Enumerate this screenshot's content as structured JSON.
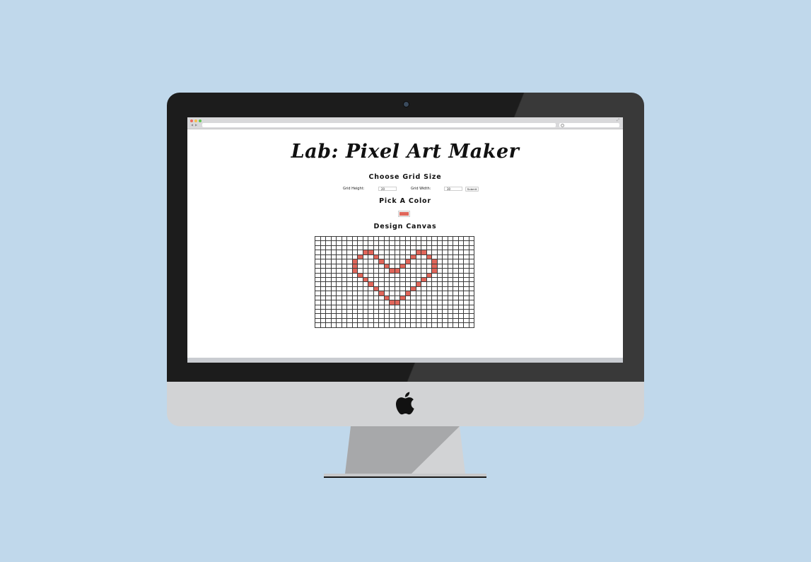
{
  "page": {
    "title": "Lab: Pixel Art Maker"
  },
  "grid_form": {
    "heading": "Choose Grid Size",
    "height_label": "Grid Height:",
    "height_value": "20",
    "width_label": "Grid Width:",
    "width_value": "30",
    "submit_label": "Submit"
  },
  "color_section": {
    "heading": "Pick A Color",
    "selected_color": "#e0665a"
  },
  "canvas_section": {
    "heading": "Design Canvas",
    "rows": 20,
    "cols": 30,
    "filled_color": "#e0665a",
    "filled_cells": [
      [
        3,
        9
      ],
      [
        3,
        10
      ],
      [
        3,
        19
      ],
      [
        3,
        20
      ],
      [
        4,
        8
      ],
      [
        4,
        11
      ],
      [
        4,
        18
      ],
      [
        4,
        21
      ],
      [
        5,
        7
      ],
      [
        5,
        12
      ],
      [
        5,
        17
      ],
      [
        5,
        22
      ],
      [
        6,
        7
      ],
      [
        6,
        13
      ],
      [
        6,
        16
      ],
      [
        6,
        22
      ],
      [
        7,
        7
      ],
      [
        7,
        14
      ],
      [
        7,
        15
      ],
      [
        7,
        22
      ],
      [
        8,
        8
      ],
      [
        8,
        21
      ],
      [
        9,
        9
      ],
      [
        9,
        20
      ],
      [
        10,
        10
      ],
      [
        10,
        19
      ],
      [
        11,
        11
      ],
      [
        11,
        18
      ],
      [
        12,
        12
      ],
      [
        12,
        17
      ],
      [
        13,
        13
      ],
      [
        13,
        16
      ],
      [
        14,
        14
      ],
      [
        14,
        15
      ]
    ]
  },
  "icons": {
    "browser_back": "back-arrow-icon",
    "browser_forward": "forward-arrow-icon",
    "search": "search-icon",
    "expand": "expand-icon",
    "apple": "apple-logo-icon"
  }
}
